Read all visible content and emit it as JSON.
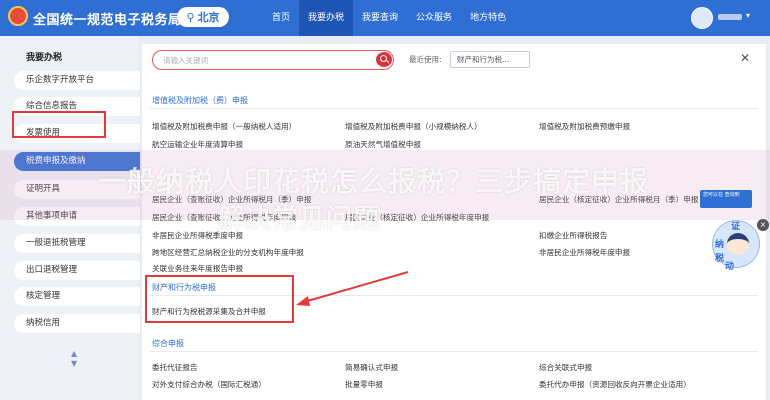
{
  "header": {
    "app_title": "全国统一规范电子税务局",
    "region": "北京",
    "nav": [
      "首页",
      "我要办税",
      "我要查询",
      "公众服务",
      "地方特色"
    ],
    "active_nav": 1
  },
  "sidebar": {
    "header": "我要办税",
    "items": [
      "乐企数字开放平台",
      "综合信息报告",
      "发票使用",
      "税费申报及缴纳",
      "证明开具",
      "其他事项申请",
      "一般退抵税管理",
      "出口退税管理",
      "核定管理",
      "纳税信用"
    ]
  },
  "search": {
    "placeholder": "请输入关键词"
  },
  "recent": {
    "label": "最近使用:",
    "tag": "财产和行为税..."
  },
  "sections": {
    "vat": {
      "title": "增值税及附加税（费）申报",
      "links": [
        "增值税及附加税费申报（一般纳税人适用）",
        "增值税及附加税费申报（小规模纳税人）",
        "增值税及附加税费预缴申报",
        "航空运输企业年度清算申报",
        "原油天然气增值税申报"
      ]
    },
    "cit": {
      "links": [
        "居民企业（查账征收）企业所得税月（季）申报",
        "居民企业（核定征收）企业所得税月（季）申报",
        "居民企业（查账征收）企业所得税年度申报",
        "居民企业（核定征收）企业所得税年度申报",
        "非居民企业所得税季度申报",
        "扣缴企业所得税报告",
        "跨地区经营汇总纳税企业的分支机构年度申报",
        "非居民企业所得税年度申报",
        "关联业务往来年度报告申报"
      ]
    },
    "property": {
      "title": "财产和行为税申报",
      "links": [
        "财产和行为税税源采集及合并申报"
      ]
    },
    "comprehensive": {
      "title": "综合申报",
      "links": [
        "委托代征报告",
        "简易确认式申报",
        "综合关联式申报",
        "对外支付综合办税（国际汇税通）",
        "批量零申报",
        "委托代办申报（资源回收反向开票企业适用）"
      ]
    }
  },
  "overlay": {
    "line1": "一般纳税人印花税怎么报税？三步搞定申报",
    "line2": "解决常见问题"
  },
  "side_widget": {
    "text": "您可以在 查询到"
  },
  "mascot": {
    "chars": [
      "证",
      "纳",
      "税",
      "动"
    ]
  },
  "colors": {
    "brand_blue": "#2f6fd4",
    "highlight_red": "#e03a3a"
  }
}
